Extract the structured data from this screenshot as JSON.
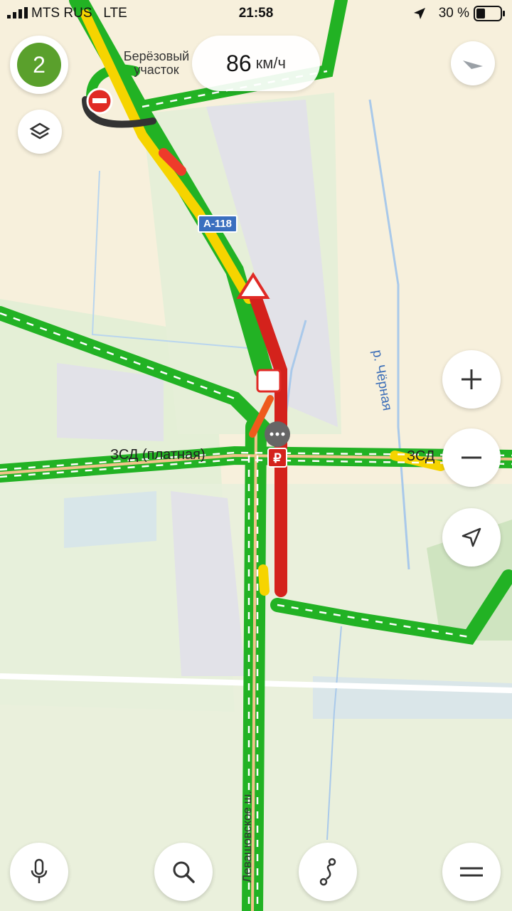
{
  "status_bar": {
    "carrier": "MTS RUS",
    "network": "LTE",
    "time": "21:58",
    "battery": "30 %"
  },
  "speed": {
    "value": "86",
    "unit": "км/ч"
  },
  "notifications_badge": "2",
  "labels": {
    "place": "Берёзовый участок",
    "highway_shield": "А-118",
    "road_main": "ЗСД (платная)",
    "road_east": "ЗСД",
    "river": "р. Чёрная",
    "street": "Левашовское ш."
  },
  "icons": {
    "layers": "layers-icon",
    "compass": "compass-icon",
    "zoom_in": "plus-icon",
    "zoom_out": "minus-icon",
    "locate": "locate-arrow-icon",
    "voice": "microphone-icon",
    "search": "search-icon",
    "route": "route-icon",
    "menu": "menu-icon"
  }
}
